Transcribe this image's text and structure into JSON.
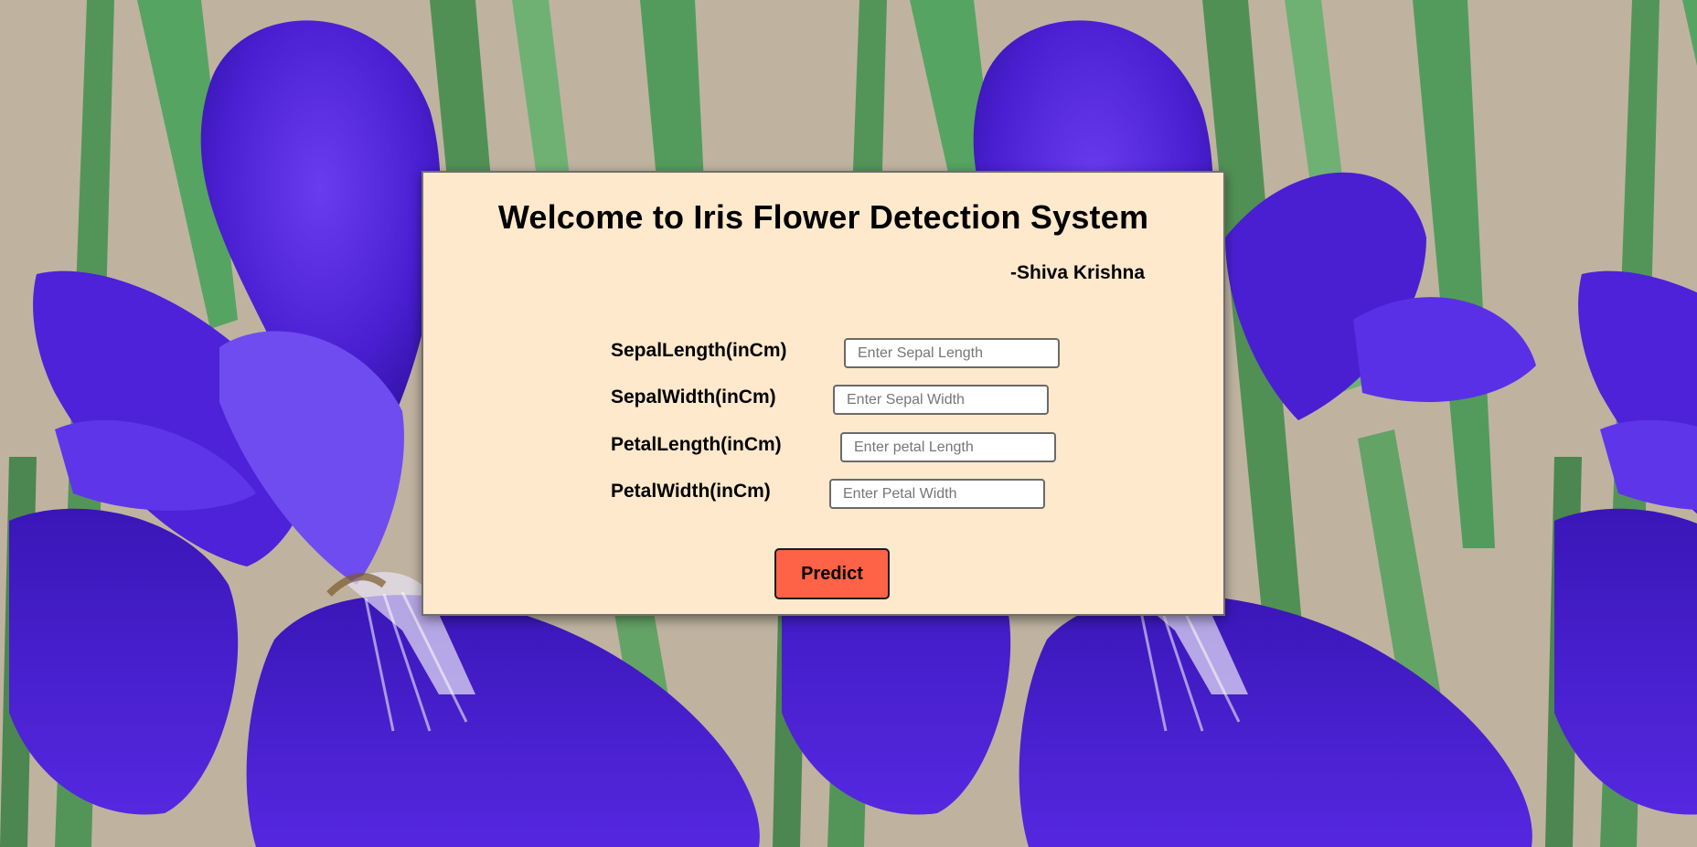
{
  "page": {
    "title": "Welcome to Iris Flower Detection System",
    "author": "-Shiva Krishna"
  },
  "form": {
    "fields": [
      {
        "label": "SepalLength(inCm)",
        "placeholder": "Enter Sepal Length",
        "value": ""
      },
      {
        "label": "SepalWidth(inCm)",
        "placeholder": "Enter Sepal Width",
        "value": ""
      },
      {
        "label": "PetalLength(inCm)",
        "placeholder": "Enter petal Length",
        "value": ""
      },
      {
        "label": "PetalWidth(inCm)",
        "placeholder": "Enter Petal Width",
        "value": ""
      }
    ],
    "submit_label": "Predict"
  },
  "colors": {
    "card_background": "#ffe9cc",
    "button_background": "#ff6347",
    "flower_purple": "#4b1fd6"
  }
}
